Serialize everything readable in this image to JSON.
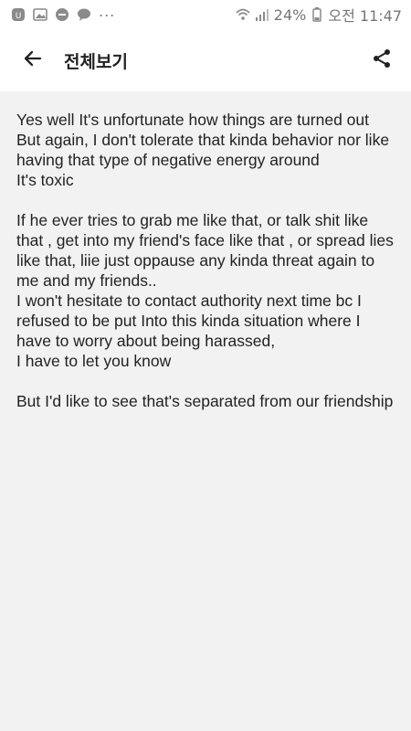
{
  "status_bar": {
    "battery_percent": "24%",
    "time": "오전 11:47",
    "notification_icons": [
      "app-icon",
      "gallery-icon",
      "sale-badge-icon",
      "chat-icon"
    ],
    "overflow": "..."
  },
  "appbar": {
    "title": "전체보기",
    "back_icon": "arrow-left-icon",
    "share_icon": "share-icon"
  },
  "message": {
    "paragraphs": [
      [
        "Yes well It's unfortunate how things are turned out",
        "But again, I don't tolerate that kinda behavior nor like having that type of negative energy around",
        "It's toxic"
      ],
      [
        "If he ever tries to grab me like that, or talk shit like that , get into my friend's face like that , or spread lies like that, liie just oppause any kinda threat again to me and my friends..",
        "I won't hesitate to contact authority next time bc I refused to be put Into this kinda situation where I have to worry about being harassed,",
        "I have to let you know"
      ],
      [
        "But I'd like to see that's separated from our friendship"
      ]
    ]
  }
}
